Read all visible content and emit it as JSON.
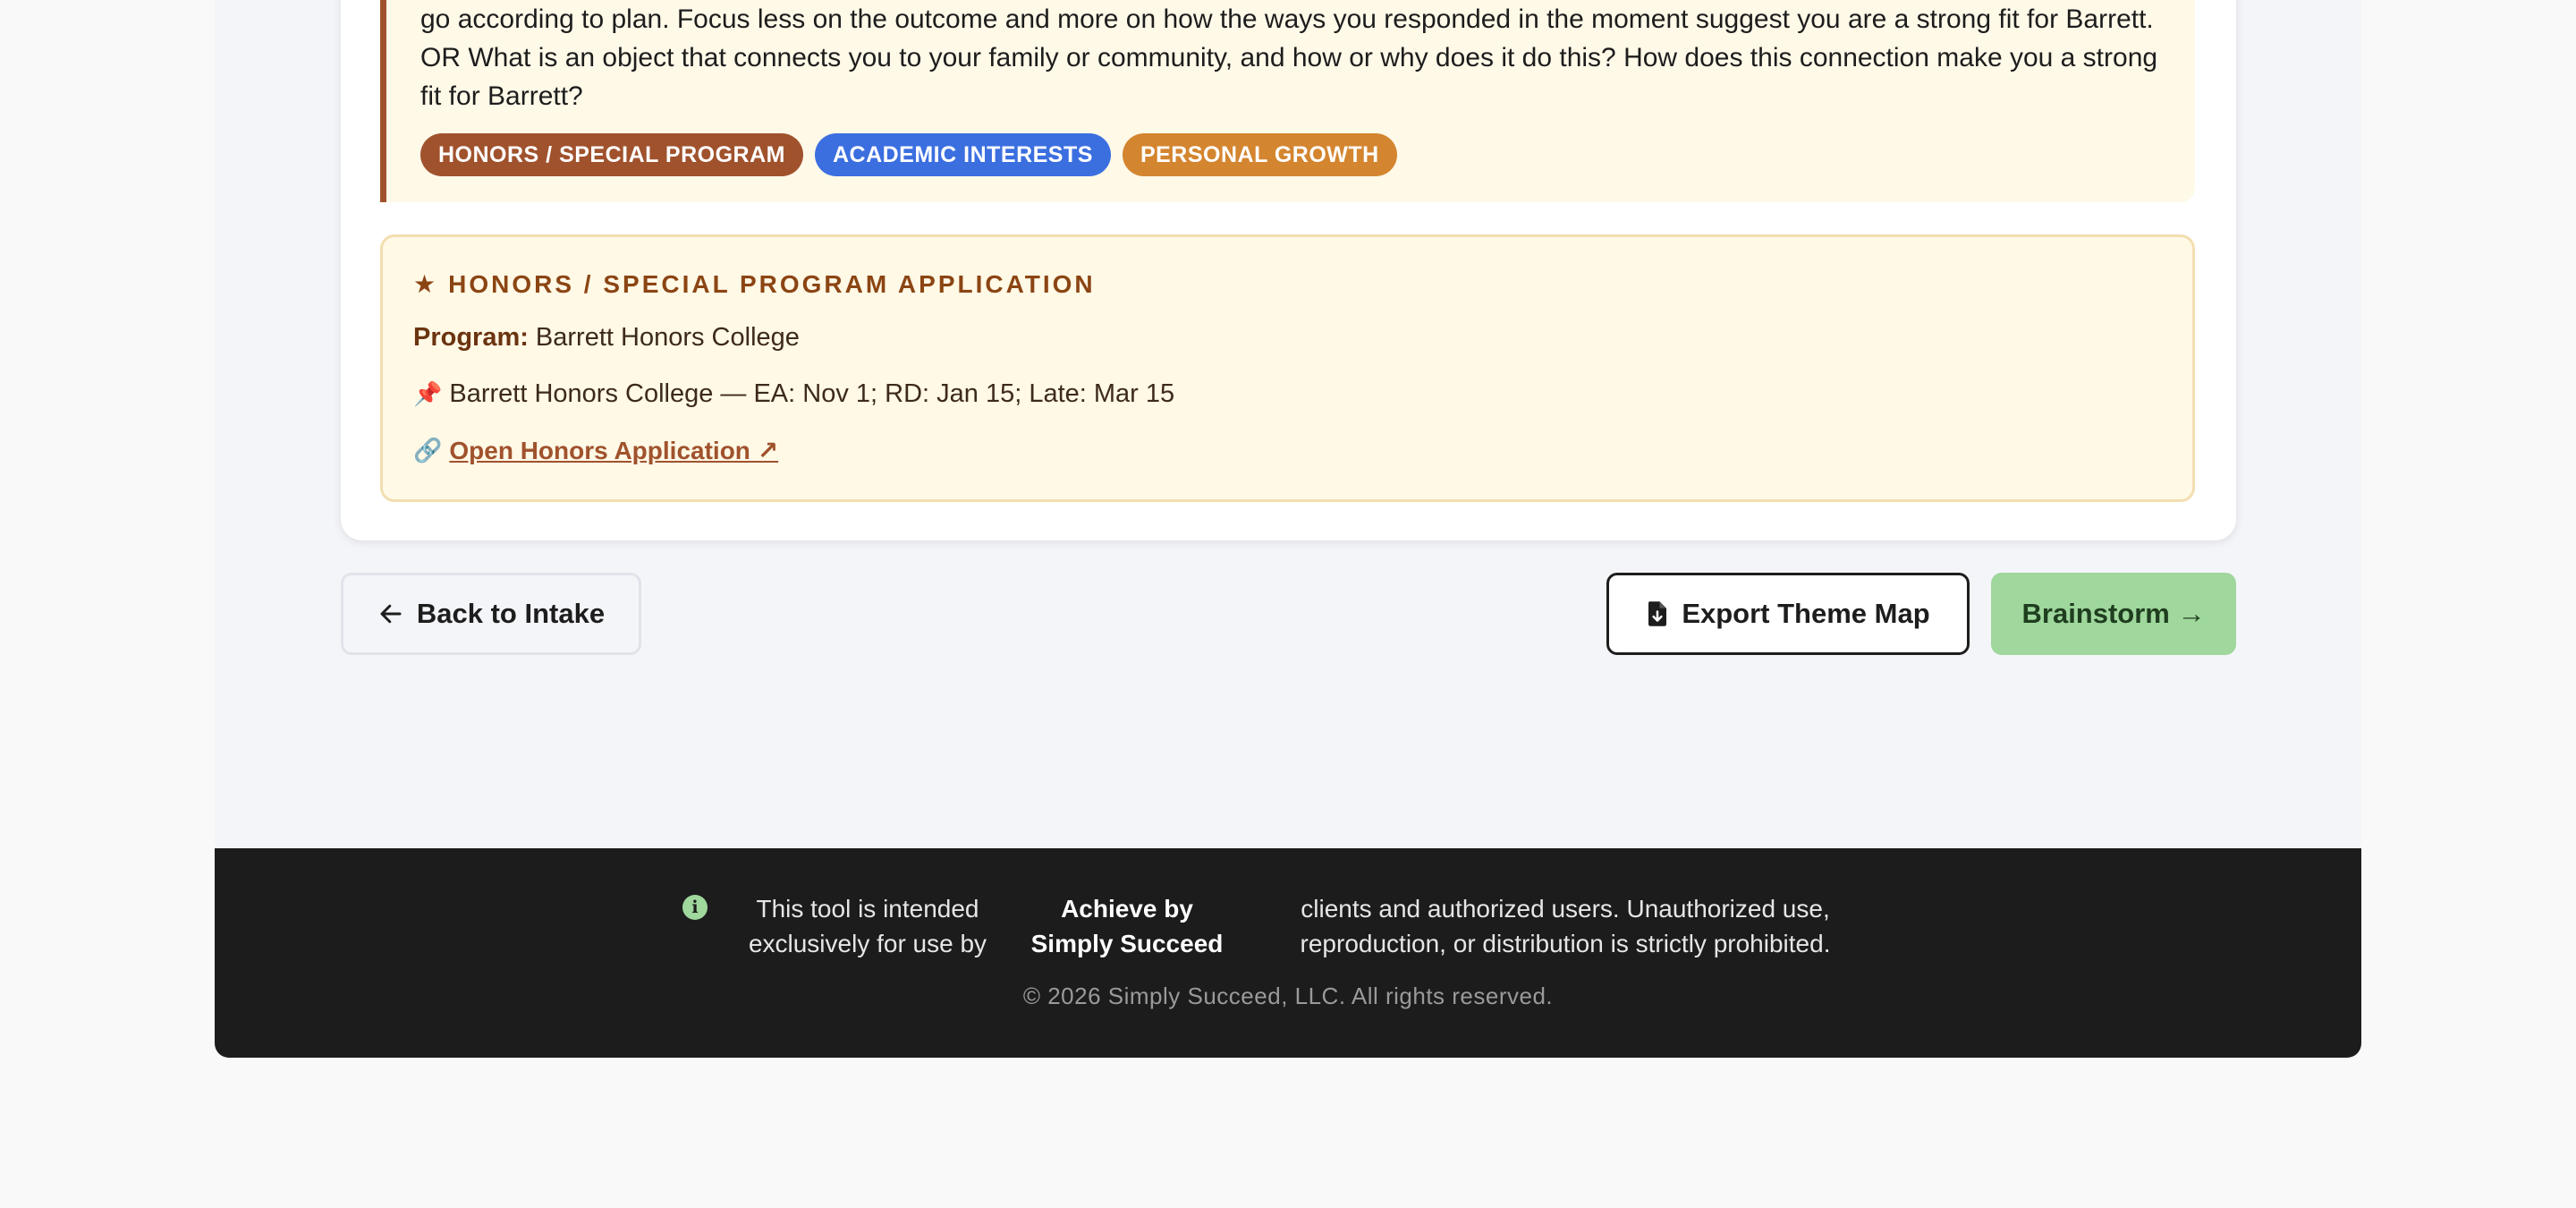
{
  "prompt": {
    "lines": [
      "go according to plan. Focus less on the outcome and more on how the ways you responded in the moment suggest you are a strong fit for Barrett.",
      "OR What is an object that connects you to your family or community, and how or why does it do this? How does this connection make you a strong",
      "fit for Barrett?"
    ],
    "tags": [
      {
        "label": "HONORS / SPECIAL PROGRAM",
        "color": "#a0522d"
      },
      {
        "label": "ACADEMIC INTERESTS",
        "color": "#3b6fe0"
      },
      {
        "label": "PERSONAL GROWTH",
        "color": "#d4852f"
      }
    ]
  },
  "honors": {
    "icon": "star-icon",
    "title": "HONORS / SPECIAL PROGRAM APPLICATION",
    "program_label": "Program:",
    "program_value": "Barrett Honors College",
    "deadline_icon": "pushpin-icon",
    "deadlines": "Barrett Honors College — EA: Nov 1; RD: Jan 15; Late: Mar 15",
    "link_icon": "link-icon",
    "link_label": "Open Honors Application ↗"
  },
  "actions": {
    "back_label": "Back to Intake",
    "back_icon": "arrow-left-icon",
    "export_label": "Export Theme Map",
    "export_icon": "file-export-icon",
    "brainstorm_label": "Brainstorm →",
    "accent_green": "#9fd79c"
  },
  "footer": {
    "icon": "info-icon",
    "notice_part1": "This tool is intended exclusively for use by",
    "notice_brand": "Achieve by Simply Succeed",
    "notice_part2": "clients and authorized users. Unauthorized use, reproduction, or distribution is strictly prohibited.",
    "copyright": "© 2026 Simply Succeed, LLC. All rights reserved."
  }
}
